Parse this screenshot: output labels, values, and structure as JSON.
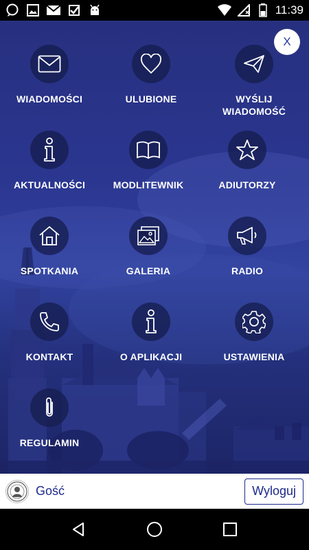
{
  "status_bar": {
    "time": "11:39",
    "left_icons": [
      "chat-bubble-icon",
      "image-icon",
      "mail-icon",
      "check-box-icon",
      "android-icon"
    ],
    "right_icons": [
      "wifi-icon",
      "signal-icon",
      "battery-icon"
    ]
  },
  "menu": {
    "close_label": "X",
    "items": [
      {
        "label": "WIADOMOŚCI",
        "icon": "envelope-icon"
      },
      {
        "label": "ULUBIONE",
        "icon": "heart-icon"
      },
      {
        "label": "WYŚLIJ\nWIADOMOŚĆ",
        "icon": "paper-plane-icon"
      },
      {
        "label": "AKTUALNOŚCI",
        "icon": "info-icon"
      },
      {
        "label": "MODLITEWNIK",
        "icon": "book-icon"
      },
      {
        "label": "ADIUTORZY",
        "icon": "star-icon"
      },
      {
        "label": "SPOTKANIA",
        "icon": "home-icon"
      },
      {
        "label": "GALERIA",
        "icon": "gallery-icon"
      },
      {
        "label": "RADIO",
        "icon": "megaphone-icon"
      },
      {
        "label": "KONTAKT",
        "icon": "phone-icon"
      },
      {
        "label": "O APLIKACJI",
        "icon": "info-icon"
      },
      {
        "label": "USTAWIENIA",
        "icon": "gear-icon"
      },
      {
        "label": "REGULAMIN",
        "icon": "paperclip-icon"
      }
    ]
  },
  "user_bar": {
    "user_name": "Gość",
    "logout_label": "Wyloguj"
  },
  "colors": {
    "accent": "#1d2a8a",
    "overlay": "#2b3690",
    "icon_circle": "#161e50"
  }
}
